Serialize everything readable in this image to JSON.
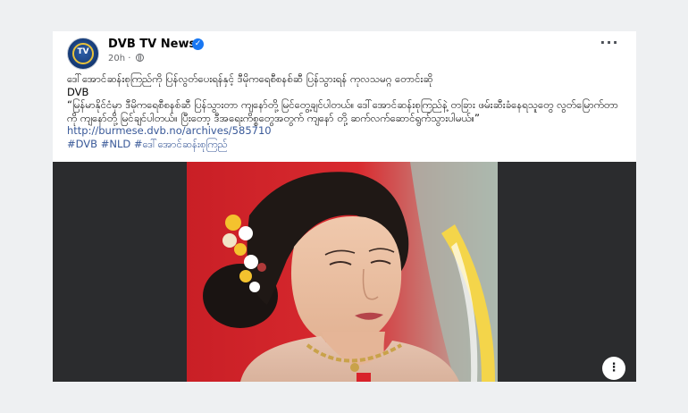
{
  "post": {
    "page_name": "DVB TV News",
    "avatar_text": "TV",
    "timestamp": "20h",
    "body_line1": "ဒေါ်အောင်ဆန်းစုကြည်ကို ပြန်လွတ်ပေးရန်နှင့် ဒီမိုကရေစီစနစ်ဆီ ပြန်သွားရန် ကုလသမဂ္ဂ တောင်းဆို",
    "body_source": "DVB",
    "body_quote": "“မြန်မာနိုင်ငံမှာ ဒီမိုကရေစီစနစ်ဆီ ပြန်သွားတာ ကျနော်တို့ မြင်တွေ့ချင်ပါတယ်။ ဒေါ်အောင်ဆန်းစုကြည်နဲ့ တခြား ဖမ်းဆီးခံနေရသူတွေ လွတ်မြောက်တာကို ကျနော်တို့ မြင်ချင်ပါတယ်။ ပြီးတော့ ဒီအရေးကိစ္စတွေအတွက် ကျနော် တို့ ဆက်လက်ဆောင်ရွက်သွားပါမယ်။”",
    "link": "http://burmese.dvb.no/archives/585710",
    "hashtags": "#DVB #NLD #ဒေါ်အောင်ဆန်းစုကြည်"
  },
  "icons": {
    "verified": "verified-check-icon",
    "privacy": "globe-icon",
    "menu": "more-options-icon",
    "photo_more": "photo-more-icon"
  },
  "colors": {
    "link": "#385898",
    "verified": "#1877f2",
    "flag_red": "#d8222a"
  }
}
